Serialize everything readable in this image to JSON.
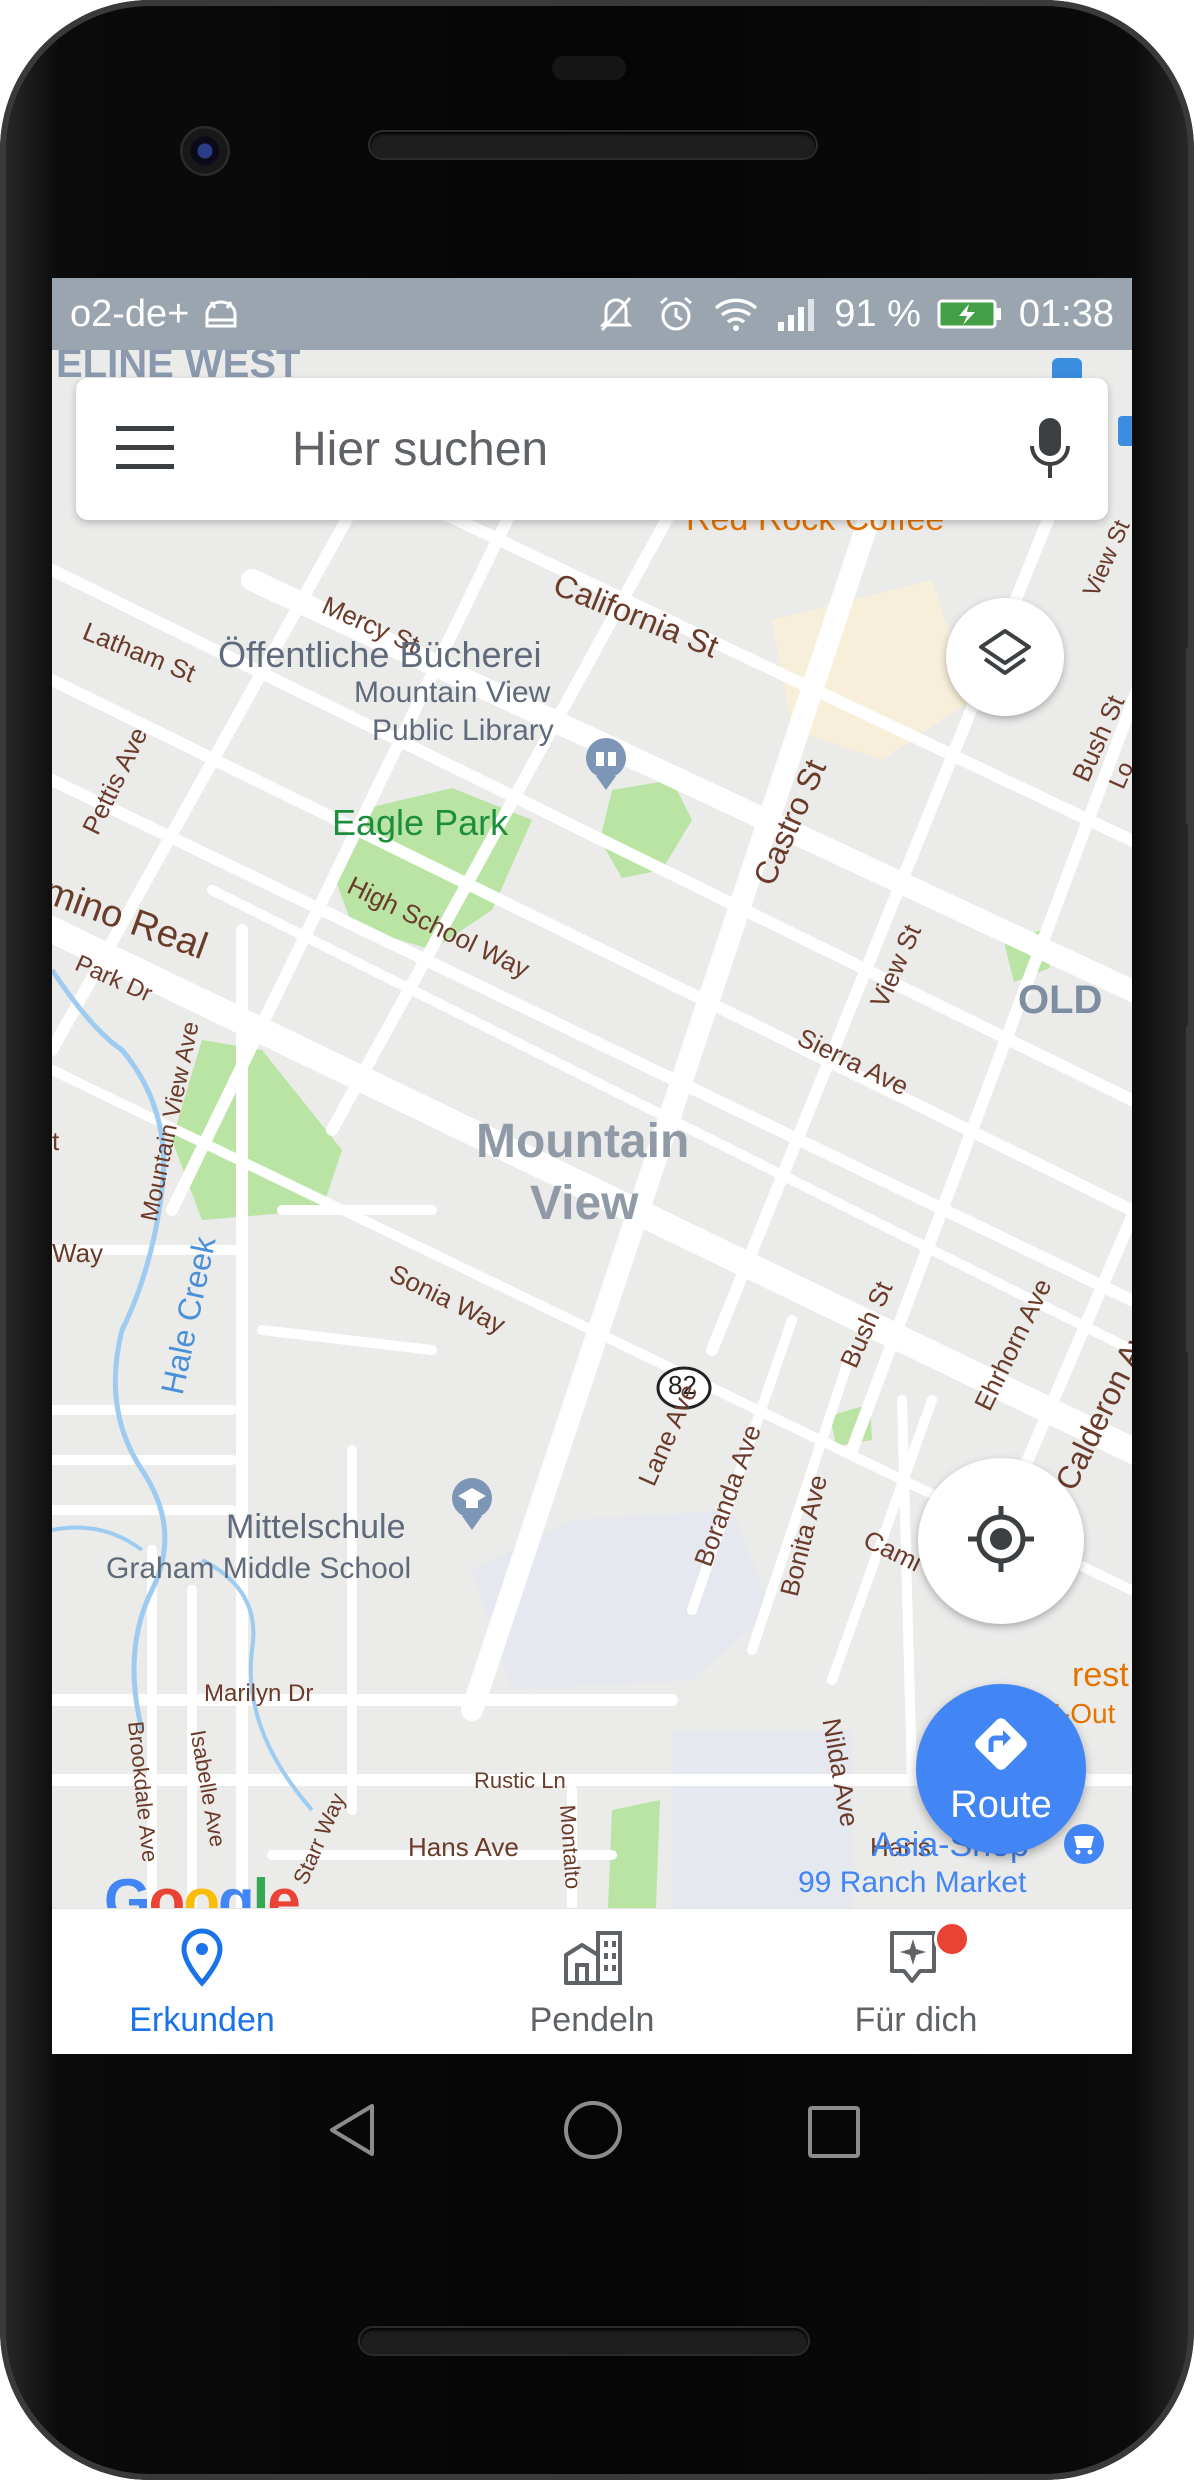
{
  "status_bar": {
    "carrier": "o2-de+",
    "battery": "91 %",
    "time": "01:38",
    "icons": [
      "android-debug-icon",
      "mute-icon",
      "alarm-icon",
      "wifi-icon",
      "signal-icon",
      "battery-charging-icon"
    ]
  },
  "search": {
    "placeholder": "Hier suchen",
    "menu_icon": "hamburger-menu-icon",
    "mic_icon": "microphone-icon"
  },
  "map": {
    "places": {
      "library_de": "Öffentliche Bücherei",
      "library_en1": "Mountain View",
      "library_en2": "Public Library",
      "eagle_park": "Eagle Park",
      "city1": "Mountain",
      "city2": "View",
      "school_de": "Mittelschule",
      "school_en": "Graham Middle School",
      "red_rock": "Red Rock Coffee",
      "asia_shop": "Asia-Shop",
      "ranch_market": "99 Ranch Market",
      "in_n_out": "In-N-Out",
      "old_area": "OLD",
      "rest_partial": "rest",
      "hale_creek": "Hale Creek",
      "highway_shield": "82",
      "top_partial": "ELINE WEST",
      "camino_real": "mino Real"
    },
    "streets": [
      "California St",
      "Mercy St",
      "Latham St",
      "Pettis Ave",
      "Castro St",
      "Bush St",
      "View St",
      "High School Way",
      "Park Dr",
      "Mountain View Ave",
      "Sierra Ave",
      "Bush St",
      "Sonia Way",
      "Lane Ave",
      "Boranda Ave",
      "Bonita Ave",
      "Nilda Ave",
      "Ehrhorn Ave",
      "Calderon Ave",
      "Marilyn Dr",
      "Rustic Ln",
      "Hans Ave",
      "Hans",
      "Brookdale Ave",
      "Isabelle Ave",
      "Starr Way",
      "Montalto",
      "View St",
      "Lo",
      "Cami",
      "n",
      "t",
      "Way"
    ]
  },
  "buttons": {
    "layers_icon": "layers-icon",
    "location_icon": "my-location-icon",
    "route_label": "Route",
    "route_icon": "directions-icon"
  },
  "google_logo": [
    "G",
    "o",
    "o",
    "g",
    "l",
    "e"
  ],
  "google_colors": [
    "#4285f4",
    "#ea4335",
    "#fbbc05",
    "#4285f4",
    "#34a853",
    "#ea4335"
  ],
  "bottom_nav": [
    {
      "label": "Erkunden",
      "icon": "explore-pin-icon",
      "active": true
    },
    {
      "label": "Pendeln",
      "icon": "commute-icon",
      "active": false
    },
    {
      "label": "Für dich",
      "icon": "for-you-icon",
      "active": false,
      "badge": true
    }
  ],
  "system_nav": [
    "back-icon",
    "home-icon",
    "recents-icon"
  ],
  "colors": {
    "accent": "#1a73e8",
    "route_fab": "#4285f4",
    "park": "#b9e4a4",
    "street_label": "#6b3b2a",
    "poi_label": "#5f6b7a",
    "park_label": "#1e8e3e",
    "food_label": "#e37400"
  }
}
